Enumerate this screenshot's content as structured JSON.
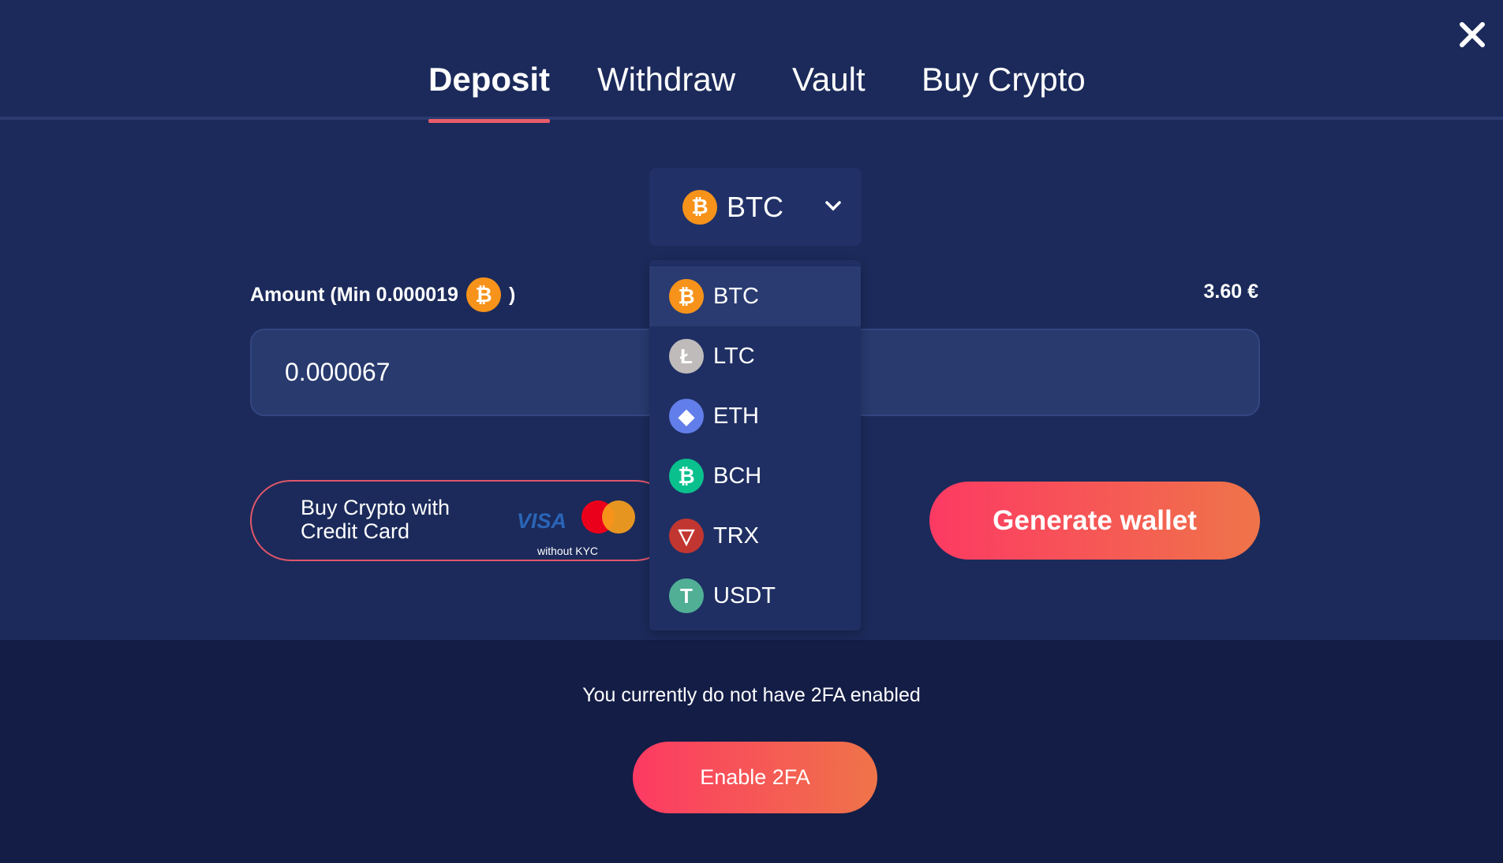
{
  "tabs": [
    {
      "label": "Deposit",
      "active": true
    },
    {
      "label": "Withdraw"
    },
    {
      "label": "Vault"
    },
    {
      "label": "Buy Crypto"
    }
  ],
  "currency_select": {
    "value": "BTC",
    "icon": "bitcoin-icon"
  },
  "amount": {
    "label": "Amount (Min 0.000019",
    "label_close": ")",
    "value": "0.000067",
    "fiat_value": "3.60 €"
  },
  "buy_card": {
    "label": "Buy Crypto with Credit Card",
    "visa": "VISA",
    "note": "without KYC"
  },
  "generate_label": "Generate wallet",
  "dropdown": [
    {
      "code": "BTC",
      "symbol": "₿",
      "color": "#f7931a"
    },
    {
      "code": "LTC",
      "symbol": "Ł",
      "color": "#bfbbbb"
    },
    {
      "code": "ETH",
      "symbol": "◆",
      "color": "#627eea"
    },
    {
      "code": "BCH",
      "symbol": "₿",
      "color": "#0ac18e"
    },
    {
      "code": "TRX",
      "symbol": "▽",
      "color": "#c23631"
    },
    {
      "code": "USDT",
      "symbol": "T",
      "color": "#50af95"
    }
  ],
  "twofa": {
    "message": "You currently do not have 2FA enabled",
    "button": "Enable 2FA"
  }
}
